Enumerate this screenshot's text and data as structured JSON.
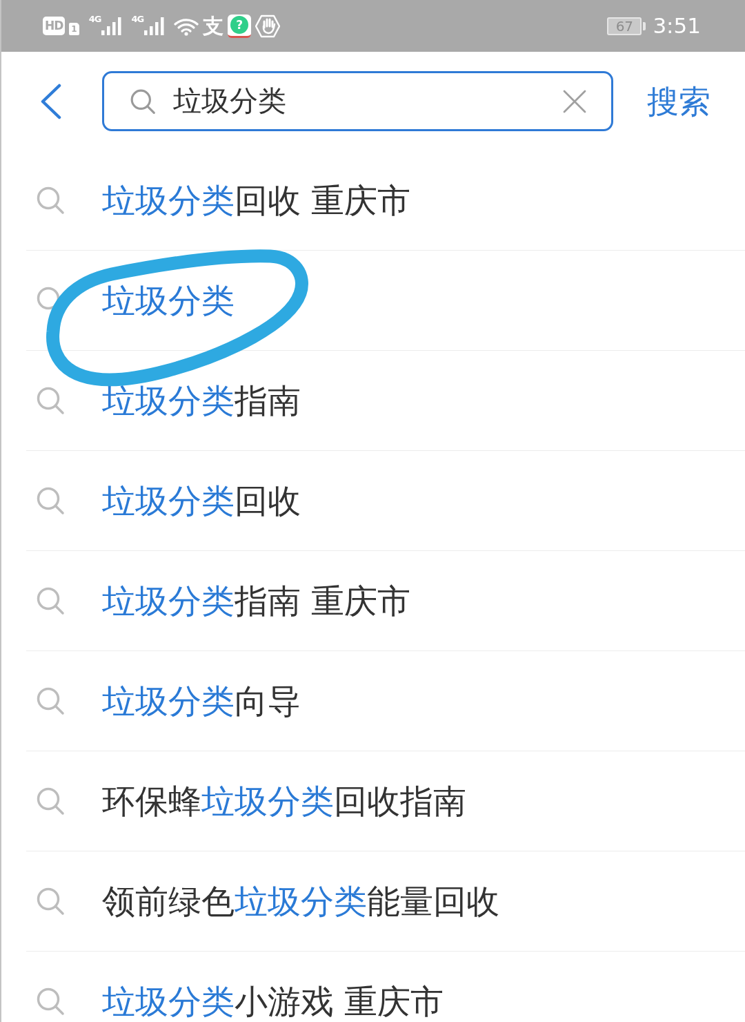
{
  "status_bar": {
    "hd": "HD",
    "sim": "1",
    "networks": [
      {
        "label": "4G"
      },
      {
        "label": "4G"
      }
    ],
    "notification_glyph": "支",
    "app_badge": "?",
    "battery": "67",
    "time": "3:51"
  },
  "header": {
    "search": {
      "value": "垃圾分类"
    },
    "search_button": "搜索"
  },
  "suggestions": [
    {
      "circled": false,
      "segments": [
        {
          "text": "垃圾分类",
          "match": true
        },
        {
          "text": "回收 重庆市",
          "match": false
        }
      ]
    },
    {
      "circled": true,
      "segments": [
        {
          "text": "垃圾分类",
          "match": true
        }
      ]
    },
    {
      "circled": false,
      "segments": [
        {
          "text": "垃圾分类",
          "match": true
        },
        {
          "text": "指南",
          "match": false
        }
      ]
    },
    {
      "circled": false,
      "segments": [
        {
          "text": "垃圾分类",
          "match": true
        },
        {
          "text": "回收",
          "match": false
        }
      ]
    },
    {
      "circled": false,
      "segments": [
        {
          "text": "垃圾分类",
          "match": true
        },
        {
          "text": "指南 重庆市",
          "match": false
        }
      ]
    },
    {
      "circled": false,
      "segments": [
        {
          "text": "垃圾分类",
          "match": true
        },
        {
          "text": "向导",
          "match": false
        }
      ]
    },
    {
      "circled": false,
      "segments": [
        {
          "text": "环保蜂",
          "match": false
        },
        {
          "text": "垃圾分类",
          "match": true
        },
        {
          "text": "回收指南",
          "match": false
        }
      ]
    },
    {
      "circled": false,
      "segments": [
        {
          "text": "领前绿色",
          "match": false
        },
        {
          "text": "垃圾分类",
          "match": true
        },
        {
          "text": "能量回收",
          "match": false
        }
      ]
    },
    {
      "circled": false,
      "segments": [
        {
          "text": "垃圾分类",
          "match": true
        },
        {
          "text": "小游戏 重庆市",
          "match": false
        }
      ]
    }
  ]
}
